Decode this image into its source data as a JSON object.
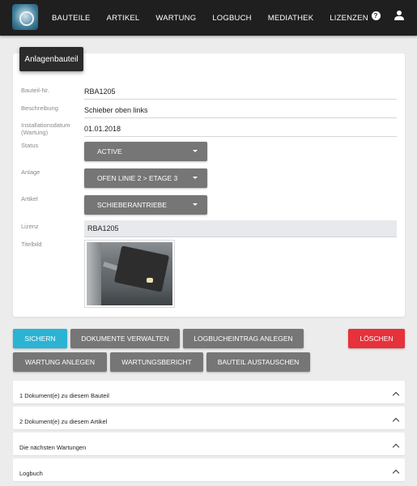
{
  "nav": {
    "items": [
      "BAUTEILE",
      "ARTIKEL",
      "WARTUNG",
      "LOGBUCH",
      "MEDIATHEK",
      "LIZENZEN"
    ],
    "help_icon": "?",
    "icons": [
      "logo",
      "help-icon",
      "user-icon"
    ]
  },
  "card": {
    "title": "Anlagenbauteil",
    "fields": {
      "part_no_label": "Bauteil-Nr.",
      "part_no_value": "RBA1205",
      "description_label": "Beschreibung",
      "description_value": "Schieber oben links",
      "install_date_label": "Installationsdatum (Wartung)",
      "install_date_value": "01.01.2018",
      "status_label": "Status",
      "status_value": "ACTIVE",
      "plant_label": "Anlage",
      "plant_value": "OFEN LINIE 2 > ETAGE 3",
      "article_label": "Artikel",
      "article_value": "SCHIEBERANTRIEBE",
      "license_label": "Lizenz",
      "license_value": "RBA1205",
      "image_label": "Titelbild"
    }
  },
  "actions": {
    "save": "SICHERN",
    "manage_documents": "DOKUMENTE VERWALTEN",
    "create_logbook_entry": "LOGBUCHEINTRAG ANLEGEN",
    "delete": "LÖSCHEN",
    "create_maintenance": "WARTUNG ANLEGEN",
    "maintenance_report": "WARTUNGSBERICHT",
    "replace_part": "BAUTEIL AUSTAUSCHEN"
  },
  "panels": [
    "1 Dokument(e) zu diesem Bauteil",
    "2 Dokument(e) zu diesem Artikel",
    "Die nächsten Wartungen",
    "Logbuch"
  ],
  "colors": {
    "topbar": "#1f1f1f",
    "primary": "#2bb3d4",
    "danger": "#e7313b",
    "neutral_button": "#767676"
  }
}
